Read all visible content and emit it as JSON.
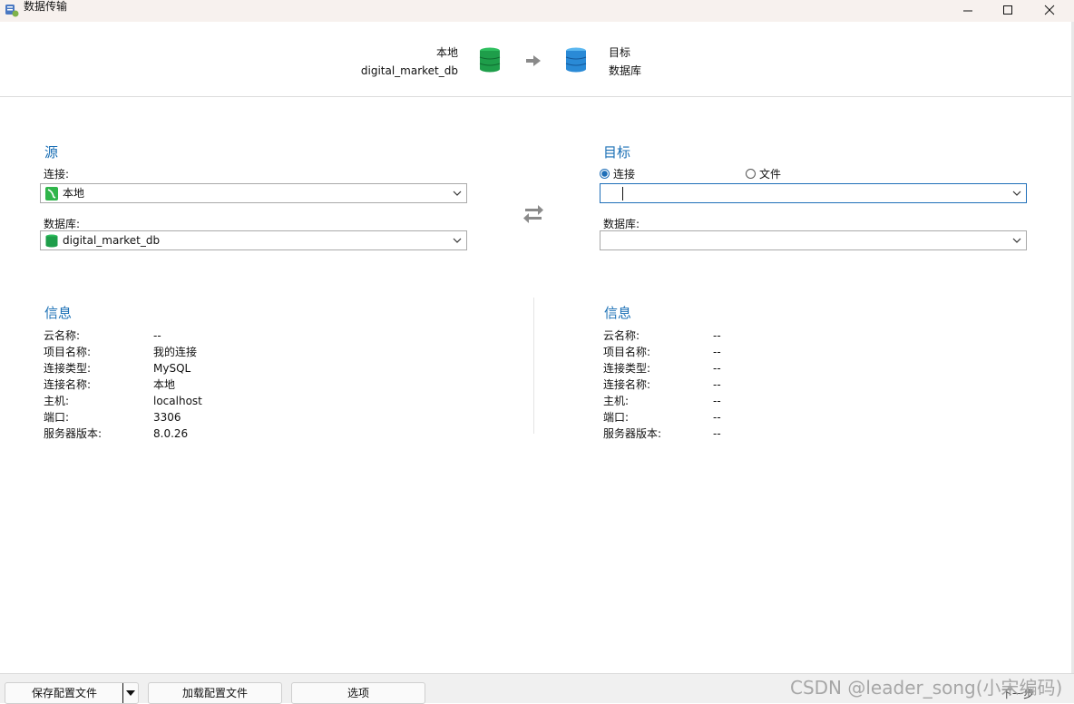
{
  "window": {
    "title": "数据传输"
  },
  "header": {
    "source_line1": "本地",
    "source_line2": "digital_market_db",
    "target_line1": "目标",
    "target_line2": "数据库",
    "source_db_color": "#1e9e4a",
    "target_db_color": "#2a8ad6"
  },
  "source": {
    "title": "源",
    "connection_label": "连接:",
    "connection_value": "本地",
    "database_label": "数据库:",
    "database_value": "digital_market_db"
  },
  "target": {
    "title": "目标",
    "radio_connection": "连接",
    "radio_file": "文件",
    "selected": "连接",
    "database_label": "数据库:",
    "connection_value": "",
    "database_value": ""
  },
  "source_info": {
    "title": "信息",
    "rows": [
      {
        "label": "云名称:",
        "value": "--"
      },
      {
        "label": "项目名称:",
        "value": "我的连接"
      },
      {
        "label": "连接类型:",
        "value": "MySQL"
      },
      {
        "label": "连接名称:",
        "value": "本地"
      },
      {
        "label": "主机:",
        "value": "localhost"
      },
      {
        "label": "端口:",
        "value": "3306"
      },
      {
        "label": "服务器版本:",
        "value": "8.0.26"
      }
    ]
  },
  "target_info": {
    "title": "信息",
    "rows": [
      {
        "label": "云名称:",
        "value": "--"
      },
      {
        "label": "项目名称:",
        "value": "--"
      },
      {
        "label": "连接类型:",
        "value": "--"
      },
      {
        "label": "连接名称:",
        "value": "--"
      },
      {
        "label": "主机:",
        "value": "--"
      },
      {
        "label": "端口:",
        "value": "--"
      },
      {
        "label": "服务器版本:",
        "value": "--"
      }
    ]
  },
  "footer": {
    "save_config": "保存配置文件",
    "load_config": "加载配置文件",
    "options": "选项",
    "next_partial": "下一步"
  },
  "watermark": "CSDN @leader_song(小宋编码)",
  "colors": {
    "accent": "#1a6fb5",
    "title_bar": "#f7f1ee"
  }
}
